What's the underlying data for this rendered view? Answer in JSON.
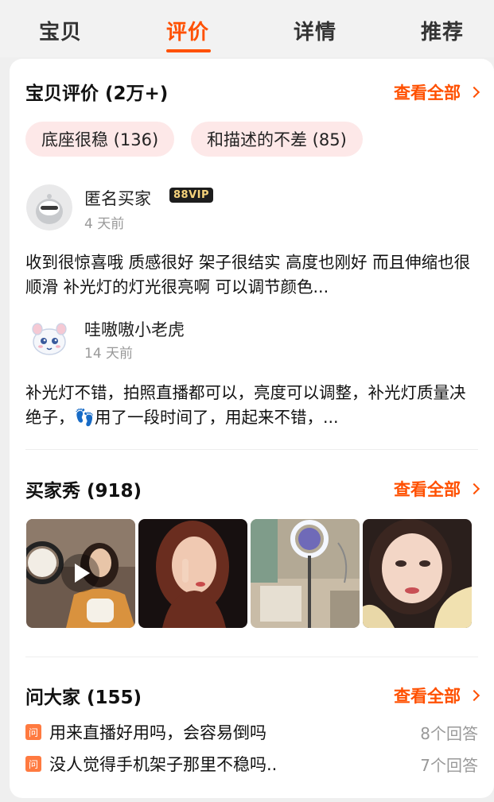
{
  "tabs": [
    {
      "label": "宝贝"
    },
    {
      "label": "评价"
    },
    {
      "label": "详情"
    },
    {
      "label": "推荐"
    }
  ],
  "reviews_section": {
    "title": "宝贝评价 (2万+)",
    "see_all": "查看全部",
    "tags": [
      "底座很稳 (136)",
      "和描述的不差 (85)"
    ],
    "items": [
      {
        "user": "匿名买家",
        "badge": "88VIP",
        "time": "4 天前",
        "text": "收到很惊喜哦 质感很好 架子很结实 高度也刚好 而且伸缩也很顺滑 补光灯的灯光很亮啊 可以调节颜色..."
      },
      {
        "user": "哇嗷嗷小老虎",
        "time": "14 天前",
        "text": "补光灯不错，拍照直播都可以，亮度可以调整，补光灯质量决绝子，👣用了一段时间了，用起来不错，..."
      }
    ]
  },
  "buyer_show": {
    "title": "买家秀 (918)",
    "see_all": "查看全部"
  },
  "qa_section": {
    "title": "问大家 (155)",
    "see_all": "查看全部",
    "icon_text": "问",
    "items": [
      {
        "question": "用来直播好用吗，会容易倒吗",
        "answers": "8个回答"
      },
      {
        "question": "没人觉得手机架子那里不稳吗..",
        "answers": "7个回答"
      }
    ]
  },
  "colors": {
    "accent": "#ff5000",
    "tag_bg": "#fde8e8"
  }
}
